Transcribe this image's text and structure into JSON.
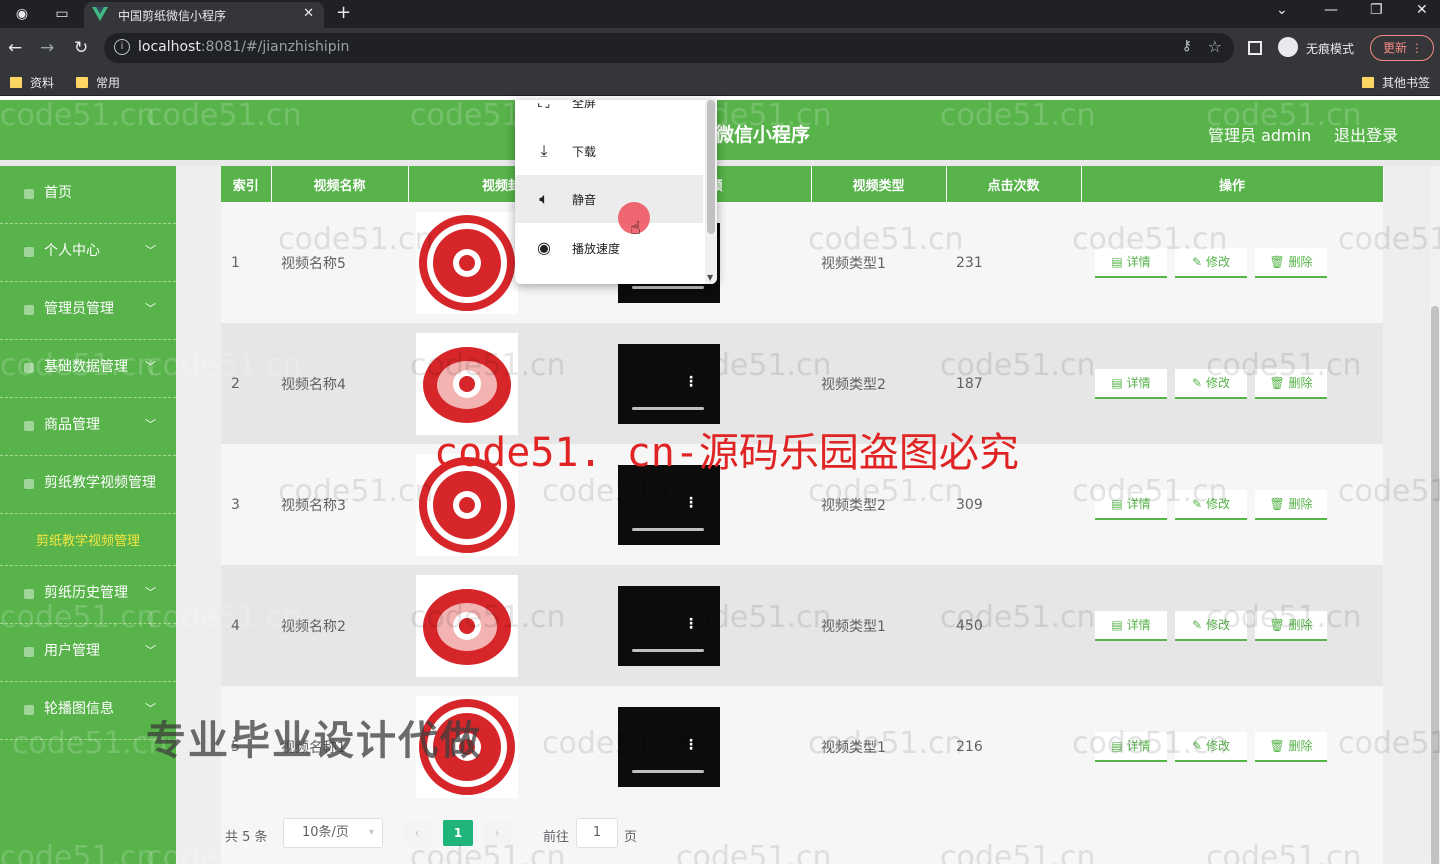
{
  "browser": {
    "tab_title": "中国剪纸微信小程序",
    "url_host": "localhost",
    "url_path": ":8081/#/jianzhishipin",
    "incognito_label": "无痕模式",
    "update_label": "更新",
    "bookmarks": [
      "资料",
      "常用"
    ],
    "other_bookmarks": "其他书签"
  },
  "header": {
    "title": "微信小程序",
    "admin_label": "管理员 admin",
    "logout": "退出登录",
    "accent_color": "#57b34a"
  },
  "sidebar": {
    "items": [
      {
        "label": "首页",
        "has_arrow": false
      },
      {
        "label": "个人中心",
        "has_arrow": true
      },
      {
        "label": "管理员管理",
        "has_arrow": true
      },
      {
        "label": "基础数据管理",
        "has_arrow": true
      },
      {
        "label": "商品管理",
        "has_arrow": true
      },
      {
        "label": "剪纸教学视频管理",
        "has_arrow": false
      },
      {
        "label": "剪纸历史管理",
        "has_arrow": true
      },
      {
        "label": "用户管理",
        "has_arrow": true
      },
      {
        "label": "轮播图信息",
        "has_arrow": true
      }
    ],
    "active_sub": "剪纸教学视频管理"
  },
  "table": {
    "headers": [
      "索引",
      "视频名称",
      "视频封面",
      "视频",
      "视频类型",
      "点击次数",
      "操作"
    ],
    "rows": [
      {
        "index": "1",
        "name": "视频名称5",
        "type": "视频类型1",
        "clicks": "231"
      },
      {
        "index": "2",
        "name": "视频名称4",
        "type": "视频类型2",
        "clicks": "187"
      },
      {
        "index": "3",
        "name": "视频名称3",
        "type": "视频类型2",
        "clicks": "309"
      },
      {
        "index": "4",
        "name": "视频名称2",
        "type": "视频类型1",
        "clicks": "450"
      },
      {
        "index": "5",
        "name": "视频名称1",
        "type": "视频类型1",
        "clicks": "216"
      }
    ],
    "actions": {
      "detail": "详情",
      "edit": "修改",
      "delete": "删除"
    }
  },
  "pagination": {
    "total": "共 5 条",
    "page_size": "10条/页",
    "current_page": "1",
    "goto_label": "前往",
    "goto_value": "1",
    "page_suffix": "页",
    "active_color": "#1fb57a"
  },
  "context_menu": {
    "items": [
      "全屏",
      "下载",
      "静音",
      "播放速度"
    ],
    "hovered": "静音"
  },
  "watermarks": {
    "site": "code51.cn",
    "banner": "code51. cn-源码乐园盗图必究",
    "promo": "专业毕业设计代做"
  }
}
